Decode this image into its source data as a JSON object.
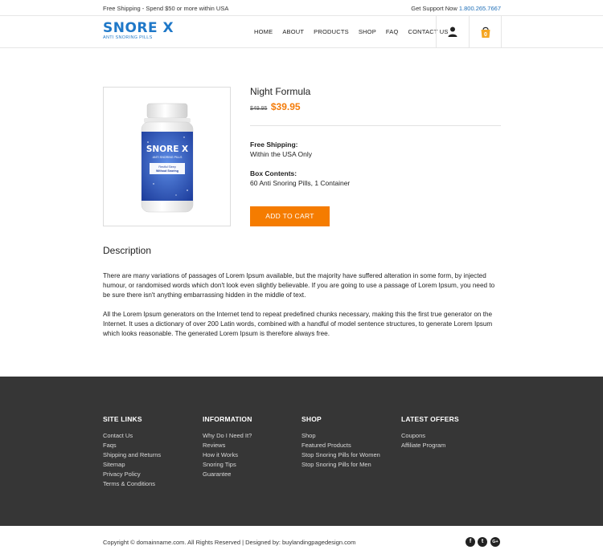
{
  "topbar": {
    "shipping_text": "Free Shipping - Spend $50 or more within USA",
    "support_label": "Get Support Now",
    "phone": "1.800.265.7667"
  },
  "header": {
    "brand": "SNORE X",
    "tagline": "ANTI SNORING PILLS",
    "nav": [
      "HOME",
      "ABOUT",
      "PRODUCTS",
      "SHOP",
      "FAQ",
      "CONTACT US"
    ],
    "cart_count": "0"
  },
  "product": {
    "title": "Night Formula",
    "old_price": "$49.95",
    "price": "$39.95",
    "shipping_label": "Free Shipping:",
    "shipping_value": "Within the USA Only",
    "contents_label": "Box Contents:",
    "contents_value": "60 Anti Snoring Pills, 1 Container",
    "add_to_cart": "ADD TO CART",
    "bottle_brand": "SNORE X",
    "bottle_tag": "ANTI SNORING PILLS",
    "bottle_line1": "Restful Sleep",
    "bottle_line2": "Without Snoring"
  },
  "description": {
    "heading": "Description",
    "p1": "There are many variations of passages of Lorem Ipsum available, but the majority have suffered alteration in some form, by injected humour, or randomised words which don't look even slightly believable. If you are going to use a passage of Lorem Ipsum, you need to be sure there isn't anything embarrassing hidden in the middle of text.",
    "p2": "All the Lorem Ipsum generators on the Internet tend to repeat predefined chunks necessary, making this the first true generator on the Internet. It uses a dictionary of over 200 Latin words, combined with a handful of model sentence structures, to generate Lorem Ipsum which looks reasonable. The generated Lorem Ipsum is therefore always free."
  },
  "footer": {
    "columns": [
      {
        "title": "SITE LINKS",
        "links": [
          "Contact Us",
          "Faqs",
          "Shipping and Returns",
          "Sitemap",
          "Privacy Policy",
          "Terms & Conditions"
        ]
      },
      {
        "title": "INFORMATION",
        "links": [
          "Why Do I Need It?",
          "Reviews",
          "How it Works",
          "Snoring Tips",
          "Guarantee"
        ]
      },
      {
        "title": "SHOP",
        "links": [
          "Shop",
          "Featured Products",
          "Stop Snoring Pills for Women",
          "Stop Snoring Pills for Men"
        ]
      },
      {
        "title": "LATEST OFFERS",
        "links": [
          "Coupons",
          "Affiliate Program"
        ]
      }
    ],
    "copyright": "Copyright © domainname.com. All Rights Reserved  |  Designed by: buylandingpagedesign.com",
    "social": [
      "f",
      "t",
      "G+"
    ]
  },
  "colors": {
    "brand_blue": "#1f78c8",
    "accent_orange": "#f57c00",
    "footer_bg": "#363636"
  }
}
